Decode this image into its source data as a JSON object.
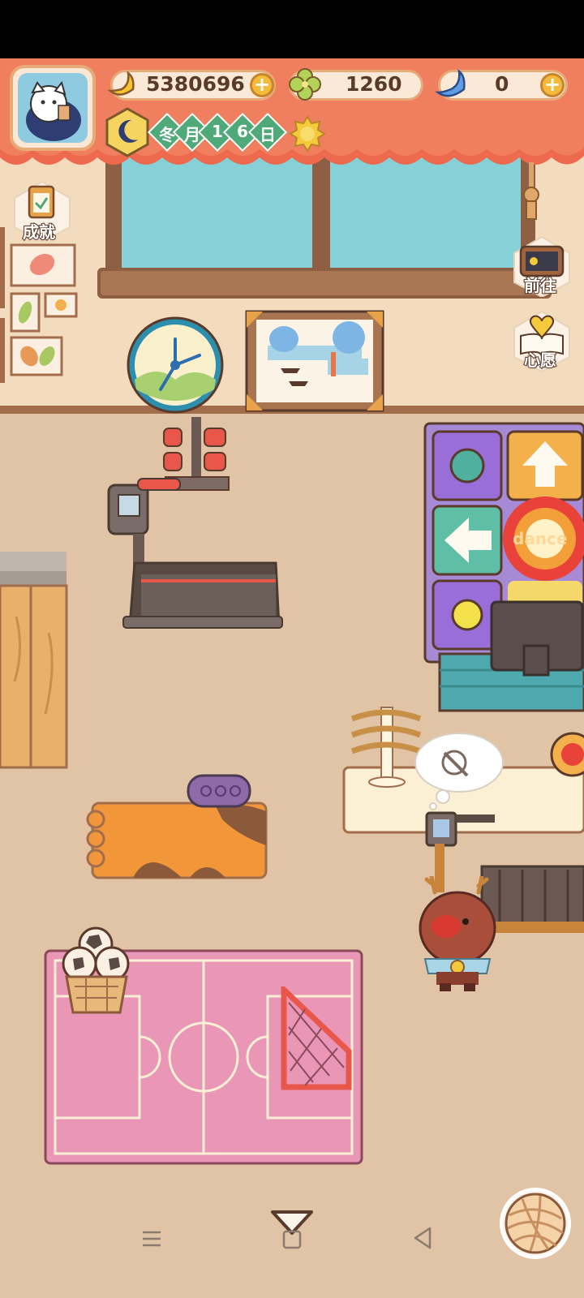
{
  "hud": {
    "bananas": "5380696",
    "clovers": "1260",
    "gems": "0",
    "date_chars": [
      "冬",
      "月",
      "1",
      "6",
      "日"
    ]
  },
  "side_buttons": {
    "achievements": "成就",
    "goto": "前往",
    "wish": "心愿"
  },
  "room": {
    "dance_mat_label": "dance"
  },
  "icons": {
    "avatar": "cat-avatar-icon",
    "banana": "banana-icon",
    "clover": "clover-icon",
    "gem": "blue-banana-icon",
    "moon": "moon-icon",
    "sun": "sun-icon",
    "yarn": "yarn-ball-icon"
  },
  "colors": {
    "curtain": "#ee6a4e",
    "wall": "#f2dcbd",
    "floor": "#e0c4a5",
    "window_glass": "#87d2d8",
    "court": "#e996b7"
  }
}
